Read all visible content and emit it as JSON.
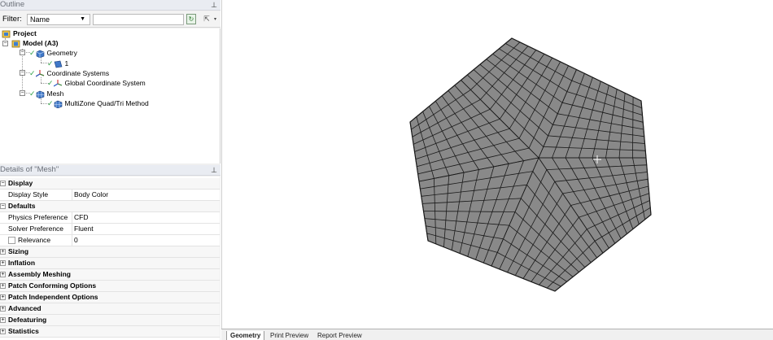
{
  "outline": {
    "title": "Outline",
    "filter_label": "Filter:",
    "filter_value": "Name",
    "tree": {
      "project": "Project",
      "model": "Model (A3)",
      "geometry": "Geometry",
      "geometry_child": "1",
      "coord_systems": "Coordinate Systems",
      "global_coord": "Global Coordinate System",
      "mesh": "Mesh",
      "multizone": "MultiZone Quad/Tri Method"
    }
  },
  "details": {
    "title": "Details of \"Mesh\"",
    "rows": {
      "display": "Display",
      "display_style_label": "Display Style",
      "display_style_value": "Body Color",
      "defaults": "Defaults",
      "physics_label": "Physics Preference",
      "physics_value": "CFD",
      "solver_label": "Solver Preference",
      "solver_value": "Fluent",
      "relevance_label": "Relevance",
      "relevance_value": "0",
      "sizing": "Sizing",
      "inflation": "Inflation",
      "assembly": "Assembly Meshing",
      "patch_conf": "Patch Conforming Options",
      "patch_indep": "Patch Independent Options",
      "advanced": "Advanced",
      "defeaturing": "Defeaturing",
      "statistics": "Statistics"
    }
  },
  "tabs": {
    "geometry": "Geometry",
    "print_preview": "Print Preview",
    "report_preview": "Report Preview"
  },
  "colors": {
    "mesh_fill": "#898989",
    "mesh_line": "#1a1a1a",
    "check_green": "#2ea043"
  },
  "icons": [
    "pin-icon",
    "refresh-icon",
    "export-icon",
    "project-icon",
    "model-icon",
    "geometry-icon",
    "coordinate-system-icon",
    "mesh-icon"
  ]
}
